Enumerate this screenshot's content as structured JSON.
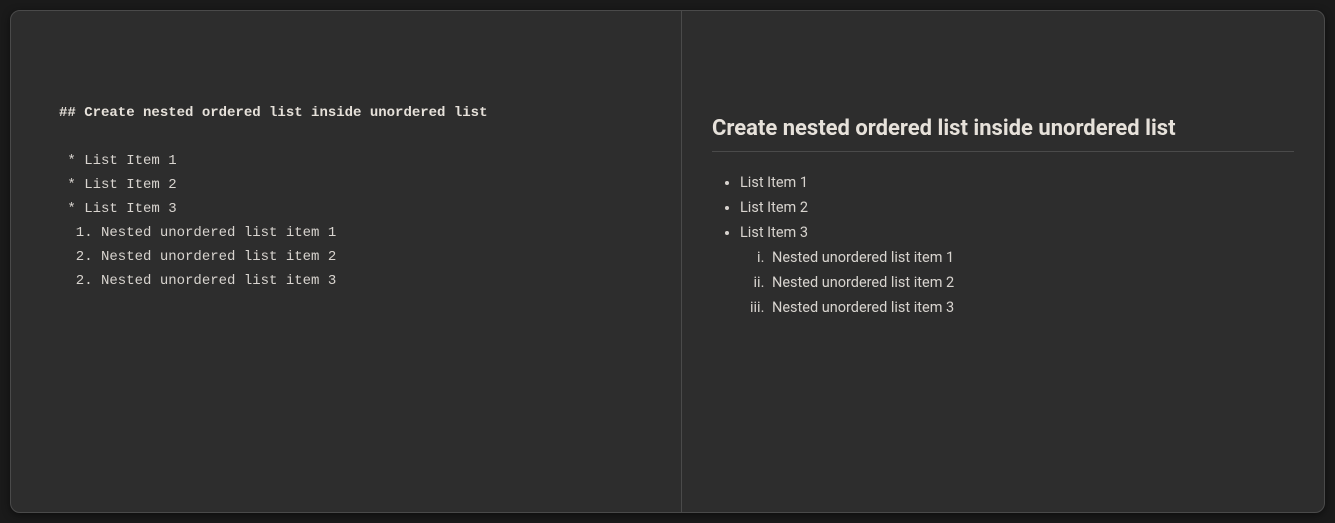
{
  "source": {
    "heading_raw": "## Create nested ordered list inside unordered list",
    "lines": [
      " * List Item 1",
      " * List Item 2",
      " * List Item 3",
      "  1. Nested unordered list item 1",
      "  2. Nested unordered list item 2",
      "  2. Nested unordered list item 3"
    ]
  },
  "preview": {
    "heading": "Create nested ordered list inside unordered list",
    "ul": [
      "List Item 1",
      "List Item 2",
      "List Item 3"
    ],
    "nested_ol": [
      "Nested unordered list item 1",
      "Nested unordered list item 2",
      "Nested unordered list item 3"
    ]
  }
}
